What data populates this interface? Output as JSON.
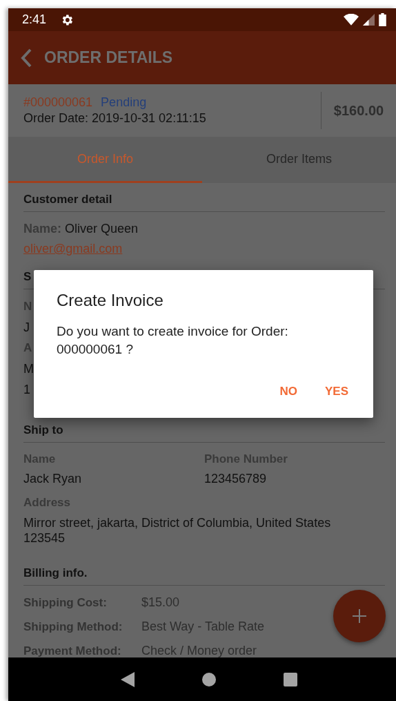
{
  "status_bar": {
    "time": "2:41"
  },
  "app_bar": {
    "title": "ORDER DETAILS"
  },
  "order": {
    "number": "#000000061",
    "status": "Pending",
    "date": "Order Date: 2019-10-31 02:11:15",
    "total": "$160.00"
  },
  "tabs": [
    {
      "label": "Order Info",
      "selected": true
    },
    {
      "label": "Order Items",
      "selected": false
    }
  ],
  "customer": {
    "title": "Customer detail",
    "name_label": "Name:",
    "name": "Oliver Queen",
    "email": "oliver@gmail.com"
  },
  "covered_section": {
    "title": "S",
    "lines": [
      {
        "kind": "label",
        "text": "N"
      },
      {
        "kind": "value",
        "text": "J"
      },
      {
        "kind": "label",
        "text": "A"
      },
      {
        "kind": "value",
        "text": "M"
      },
      {
        "kind": "value",
        "text": "1"
      }
    ]
  },
  "ship_to": {
    "title": "Ship to",
    "fields": [
      {
        "label": "Name",
        "value": "Jack Ryan"
      },
      {
        "label": "Phone Number",
        "value": "123456789"
      }
    ],
    "address_label": "Address",
    "address": "Mirror street, jakarta, District of Columbia, United States 123545"
  },
  "billing": {
    "title": "Billing info.",
    "rows": [
      {
        "label": "Shipping Cost:",
        "value": "$15.00"
      },
      {
        "label": "Shipping Method:",
        "value": "Best Way - Table Rate"
      },
      {
        "label": "Payment Method:",
        "value": "Check / Money order"
      }
    ]
  },
  "dialog": {
    "title": "Create Invoice",
    "message": "Do you want to create invoice for Order: 000000061 ?",
    "buttons": [
      "NO",
      "YES"
    ]
  }
}
